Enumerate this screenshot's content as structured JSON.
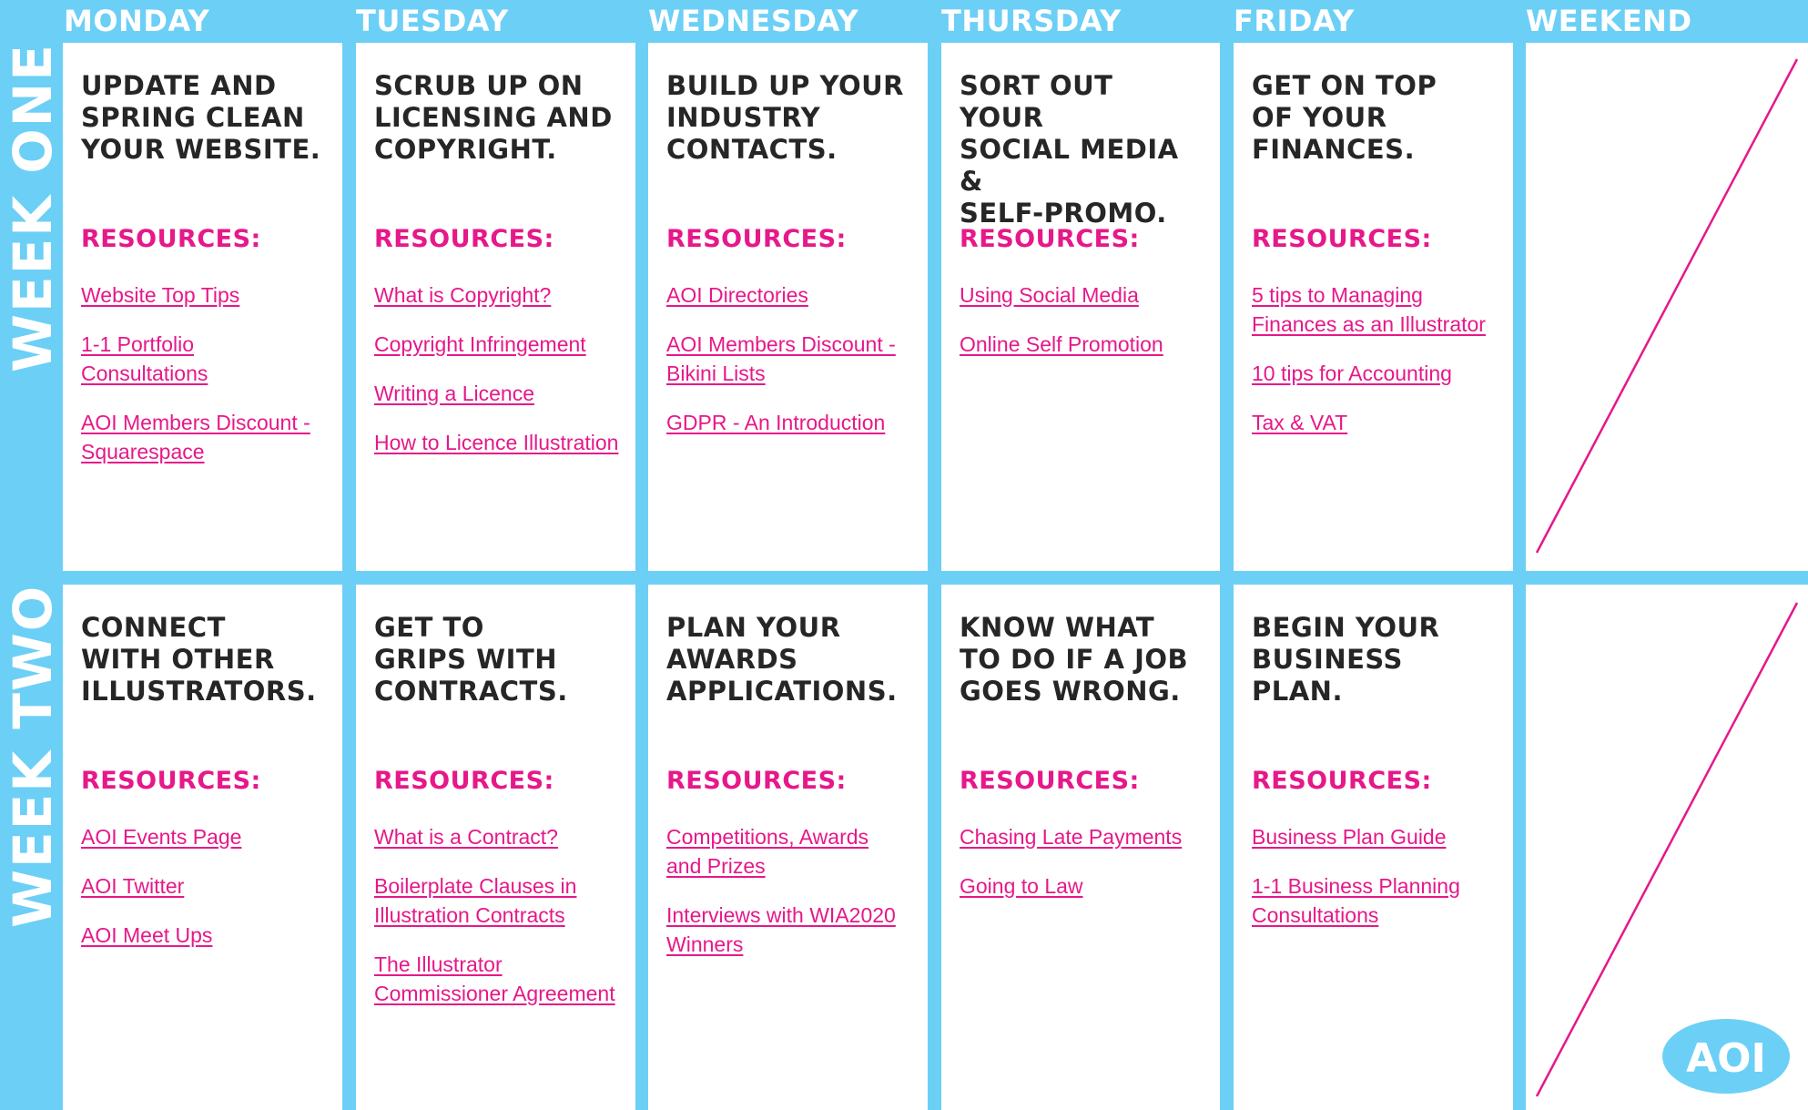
{
  "days": [
    "MONDAY",
    "TUESDAY",
    "WEDNESDAY",
    "THURSDAY",
    "FRIDAY",
    "WEEKEND"
  ],
  "weeks": [
    {
      "label": "WEEK ONE",
      "tasks": [
        {
          "title": "UPDATE AND\nSPRING CLEAN\nYOUR WEBSITE.",
          "resources_label": "RESOURCES:",
          "links": [
            "Website Top Tips",
            "1-1 Portfolio\nConsultations",
            "AOI Members Discount -\nSquarespace"
          ]
        },
        {
          "title": "SCRUB UP ON\nLICENSING AND\nCOPYRIGHT.",
          "resources_label": "RESOURCES:",
          "links": [
            "What is Copyright?",
            "Copyright Infringement",
            "Writing a Licence",
            "How to Licence Illustration"
          ]
        },
        {
          "title": "BUILD UP YOUR\nINDUSTRY\nCONTACTS.",
          "resources_label": "RESOURCES:",
          "links": [
            "AOI Directories",
            "AOI Members Discount -\nBikini Lists",
            "GDPR - An Introduction"
          ]
        },
        {
          "title": "SORT OUT YOUR\nSOCIAL MEDIA &\nSELF-PROMO.",
          "resources_label": "RESOURCES:",
          "links": [
            "Using Social Media",
            "Online Self Promotion"
          ]
        },
        {
          "title": "GET ON TOP\nOF YOUR\nFINANCES.",
          "resources_label": "RESOURCES:",
          "links": [
            "5 tips to Managing\nFinances as an Illustrator",
            "10 tips for Accounting",
            "Tax & VAT"
          ]
        }
      ]
    },
    {
      "label": "WEEK TWO",
      "tasks": [
        {
          "title": "CONNECT\nWITH OTHER\nILLUSTRATORS.",
          "resources_label": "RESOURCES:",
          "links": [
            "AOI Events Page",
            "AOI Twitter",
            "AOI Meet Ups"
          ]
        },
        {
          "title": "GET TO\nGRIPS WITH\nCONTRACTS.",
          "resources_label": "RESOURCES:",
          "links": [
            "What is a Contract?",
            "Boilerplate Clauses in\nIllustration Contracts",
            "The Illustrator\nCommissioner Agreement"
          ]
        },
        {
          "title": "PLAN YOUR\nAWARDS\nAPPLICATIONS.",
          "resources_label": "RESOURCES:",
          "links": [
            "Competitions, Awards\nand Prizes",
            "Interviews with WIA2020\nWinners"
          ]
        },
        {
          "title": "KNOW WHAT\nTO DO IF A JOB\nGOES WRONG.",
          "resources_label": "RESOURCES:",
          "links": [
            "Chasing Late Payments",
            "Going to Law"
          ]
        },
        {
          "title": "BEGIN YOUR\nBUSINESS PLAN.",
          "resources_label": "RESOURCES:",
          "links": [
            "Business Plan Guide",
            "1-1 Business Planning\nConsultations"
          ]
        }
      ]
    }
  ],
  "logo_text": "AOI",
  "colors": {
    "background": "#6ccff6",
    "card": "#ffffff",
    "title": "#262626",
    "accent": "#e6188a"
  }
}
